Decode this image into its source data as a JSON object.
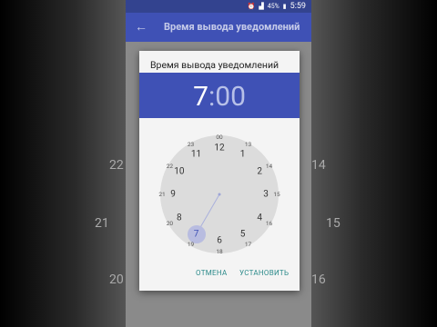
{
  "status_bar": {
    "battery_percent": "45%",
    "time": "5:59"
  },
  "app_bar": {
    "title": "Время вывода уведомлений",
    "back_icon": "arrow-back-icon"
  },
  "background_numbers": {
    "left": [
      "22",
      "21",
      "20"
    ],
    "right": [
      "14",
      "15",
      "16"
    ]
  },
  "dialog": {
    "title": "Время вывода уведомлений",
    "time": {
      "hour": "7",
      "separator": ":",
      "minutes": "00"
    },
    "clock": {
      "outer": [
        "12",
        "1",
        "2",
        "3",
        "4",
        "5",
        "6",
        "7",
        "8",
        "9",
        "10",
        "11"
      ],
      "inner": [
        "00",
        "13",
        "14",
        "15",
        "16",
        "17",
        "18",
        "19",
        "20",
        "21",
        "22",
        "23"
      ],
      "selected": "7"
    },
    "cancel_label": "ОТМЕНА",
    "ok_label": "УСТАНОВИТЬ"
  },
  "colors": {
    "primary": "#3f51b5",
    "accent": "#2b8a8a"
  }
}
